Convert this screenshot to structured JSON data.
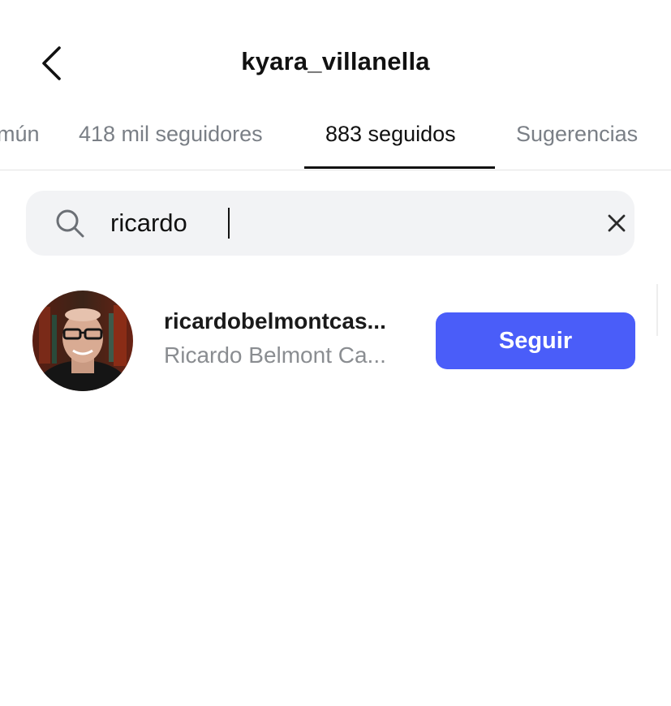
{
  "header": {
    "title": "kyara_villanella",
    "back_icon": "chevron-left-icon"
  },
  "tabs": [
    {
      "label": "mún",
      "active": false
    },
    {
      "label": "418 mil seguidores",
      "active": false
    },
    {
      "label": "883 seguidos",
      "active": true
    },
    {
      "label": "Sugerencias",
      "active": false
    }
  ],
  "search": {
    "value": "ricardo",
    "search_icon": "search-icon",
    "clear_icon": "close-icon"
  },
  "results": [
    {
      "username": "ricardobelmontcas...",
      "full_name": "Ricardo Belmont Ca...",
      "button_label": "Seguir"
    }
  ],
  "colors": {
    "accent": "#4a5df9",
    "search_bg": "#f2f3f5",
    "secondary_text": "#8a8d91",
    "tab_inactive": "#7a7f86"
  }
}
